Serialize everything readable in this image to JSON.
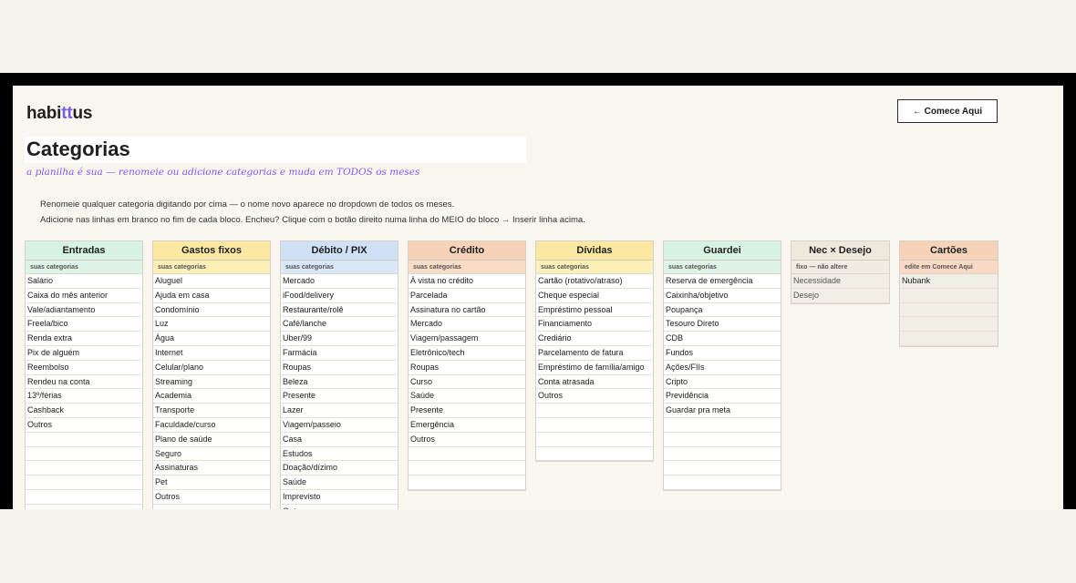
{
  "brand": {
    "prefix": "habi",
    "highlight": "tt",
    "suffix": "us",
    "highlight_color": "#7a5cf0"
  },
  "cta_label": "← Comece Aqui",
  "page": {
    "title": "Categorias",
    "subtitle": "a planilha é sua — renomeie ou adicione categorias e muda em TODOS os meses",
    "instruction_1": "Renomeie qualquer categoria digitando por cima — o nome novo aparece no dropdown de todos os meses.",
    "instruction_2": "Adicione nas linhas em branco no fim de cada bloco. Encheu? Clique com o botão direito numa linha do MEIO do bloco → Inserir linha acima."
  },
  "columns": [
    {
      "title": "Entradas",
      "subtitle": "suas categorias",
      "color": "#d5f2e2",
      "blank_rows": 6,
      "items": [
        "Salário",
        "Caixa do mês anterior",
        "Vale/adiantamento",
        "Freela/bico",
        "Renda extra",
        "Pix de alguém",
        "Reembolso",
        "Rendeu na conta",
        "13º/férias",
        "Cashback",
        "Outros"
      ]
    },
    {
      "title": "Gastos fixos",
      "subtitle": "suas categorias",
      "color": "#fbe9a2",
      "blank_rows": 1,
      "items": [
        "Aluguel",
        "Ajuda em casa",
        "Condomínio",
        "Luz",
        "Água",
        "Internet",
        "Celular/plano",
        "Streaming",
        "Academia",
        "Transporte",
        "Faculdade/curso",
        "Plano de saúde",
        "Seguro",
        "Assinaturas",
        "Pet",
        "Outros"
      ]
    },
    {
      "title": "Débito / PIX",
      "subtitle": "suas categorias",
      "color": "#cfe0f7",
      "blank_rows": 0,
      "items": [
        "Mercado",
        "iFood/delivery",
        "Restaurante/rolê",
        "Café/lanche",
        "Uber/99",
        "Farmácia",
        "Roupas",
        "Beleza",
        "Presente",
        "Lazer",
        "Viagem/passeio",
        "Casa",
        "Estudos",
        "Doação/dízimo",
        "Saúde",
        "Imprevisto",
        "Outros"
      ]
    },
    {
      "title": "Crédito",
      "subtitle": "suas categorias",
      "color": "#f6d3b8",
      "blank_rows": 3,
      "items": [
        "À vista no crédito",
        "Parcelada",
        "Assinatura no cartão",
        "Mercado",
        "Viagem/passagem",
        "Eletrônico/tech",
        "Roupas",
        "Curso",
        "Saúde",
        "Presente",
        "Emergência",
        "Outros"
      ]
    },
    {
      "title": "Dívidas",
      "subtitle": "suas categorias",
      "color": "#fbe9a2",
      "blank_rows": 4,
      "items": [
        "Cartão (rotativo/atraso)",
        "Cheque especial",
        "Empréstimo pessoal",
        "Financiamento",
        "Crediário",
        "Parcelamento de fatura",
        "Empréstimo de família/amigo",
        "Conta atrasada",
        "Outros"
      ]
    },
    {
      "title": "Guardei",
      "subtitle": "suas categorias",
      "color": "#d5f2e2",
      "blank_rows": 5,
      "items": [
        "Reserva de emergência",
        "Caixinha/objetivo",
        "Poupança",
        "Tesouro Direto",
        "CDB",
        "Fundos",
        "Ações/FIIs",
        "Cripto",
        "Previdência",
        "Guardar pra meta"
      ]
    },
    {
      "title": "Nec × Desejo",
      "subtitle": "fixo — não altere",
      "color": "#eee9dd",
      "blank_rows": 0,
      "items": [
        "Necessidade",
        "Desejo"
      ]
    },
    {
      "title": "Cartões",
      "subtitle": "edite em Comece Aqui",
      "color": "#f6d3b8",
      "blank_rows": 4,
      "items": [
        "Nubank"
      ]
    }
  ]
}
